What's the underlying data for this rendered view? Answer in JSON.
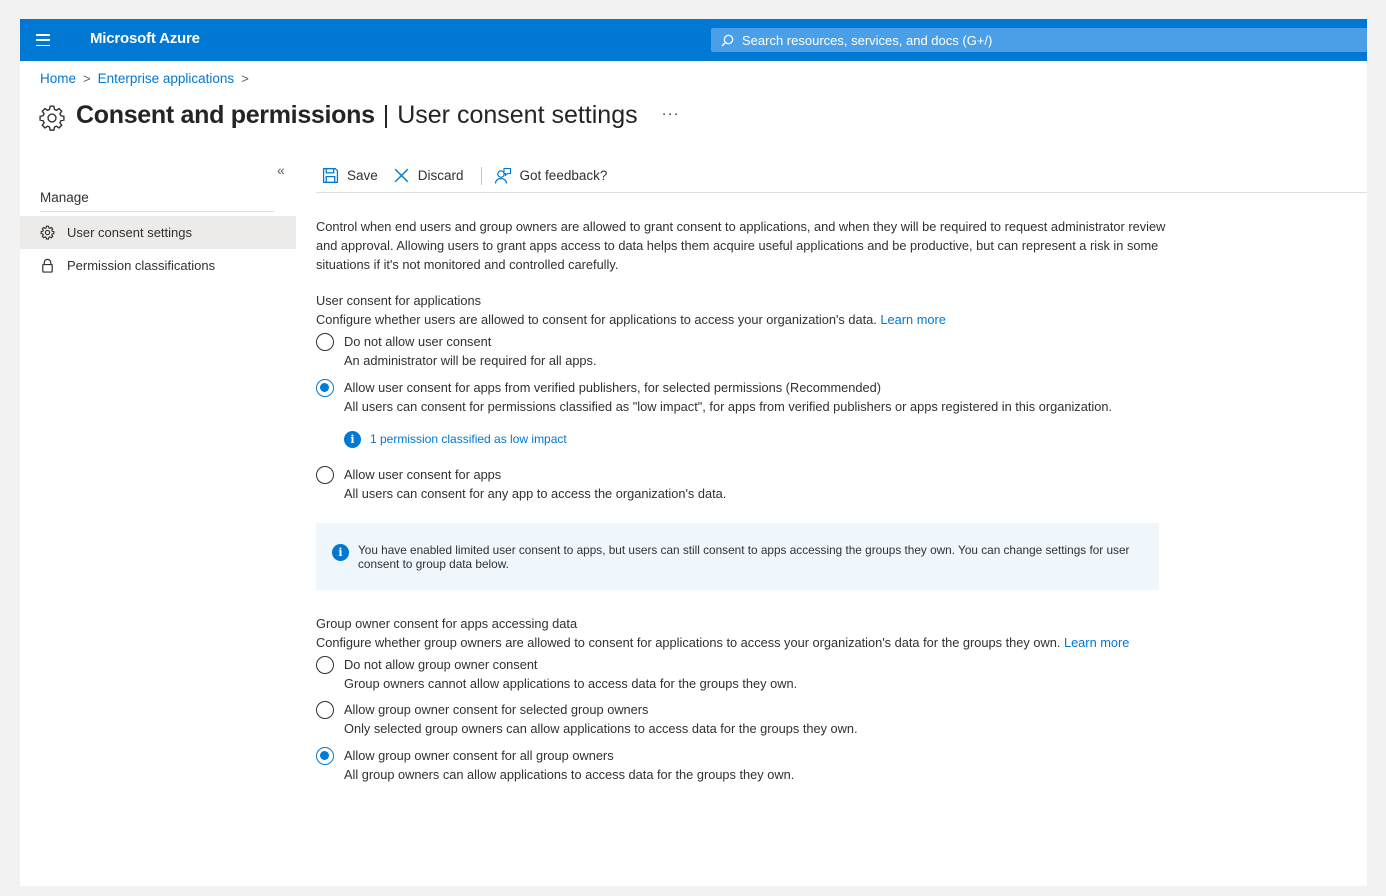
{
  "topbar": {
    "brand": "Microsoft Azure",
    "search_placeholder": "Search resources, services, and docs (G+/)"
  },
  "breadcrumb": {
    "items": [
      "Home",
      "Enterprise applications"
    ]
  },
  "page": {
    "title_main": "Consent and permissions",
    "title_sub": "User consent settings",
    "more": "···"
  },
  "sidebar": {
    "collapse": "«",
    "heading": "Manage",
    "items": [
      {
        "label": "User consent settings",
        "icon": "gear-icon"
      },
      {
        "label": "Permission classifications",
        "icon": "lock-icon"
      }
    ]
  },
  "toolbar": {
    "save": "Save",
    "discard": "Discard",
    "feedback": "Got feedback?"
  },
  "intro": "Control when end users and group owners are allowed to grant consent to applications, and when they will be required to request administrator review and approval. Allowing users to grant apps access to data helps them acquire useful applications and be productive, but can represent a risk in some situations if it's not monitored and controlled carefully.",
  "user_consent": {
    "title": "User consent for applications",
    "description": "Configure whether users are allowed to consent for applications to access your organization's data.",
    "learn_more": "Learn more",
    "options": [
      {
        "label": "Do not allow user consent",
        "desc": "An administrator will be required for all apps.",
        "checked": false
      },
      {
        "label": "Allow user consent for apps from verified publishers, for selected permissions (Recommended)",
        "desc": "All users can consent for permissions classified as \"low impact\", for apps from verified publishers or apps registered in this organization.",
        "checked": true
      },
      {
        "label": "Allow user consent for apps",
        "desc": "All users can consent for any app to access the organization's data.",
        "checked": false
      }
    ],
    "low_impact_link": "1 permission classified as low impact"
  },
  "banner": {
    "text": "You have enabled limited user consent to apps, but users can still consent to apps accessing the groups they own. You can change settings for user consent to group data below."
  },
  "group_consent": {
    "title": "Group owner consent for apps accessing data",
    "description": "Configure whether group owners are allowed to consent for applications to access your organization's data for the groups they own.",
    "learn_more": "Learn more",
    "options": [
      {
        "label": "Do not allow group owner consent",
        "desc": "Group owners cannot allow applications to access data for the groups they own.",
        "checked": false
      },
      {
        "label": "Allow group owner consent for selected group owners",
        "desc": "Only selected group owners can allow applications to access data for the groups they own.",
        "checked": false
      },
      {
        "label": "Allow group owner consent for all group owners",
        "desc": "All group owners can allow applications to access data for the groups they own.",
        "checked": true
      }
    ]
  },
  "colors": {
    "accent": "#0078d4",
    "banner_bg": "#eff6fc",
    "selected_nav": "#edebe9"
  }
}
